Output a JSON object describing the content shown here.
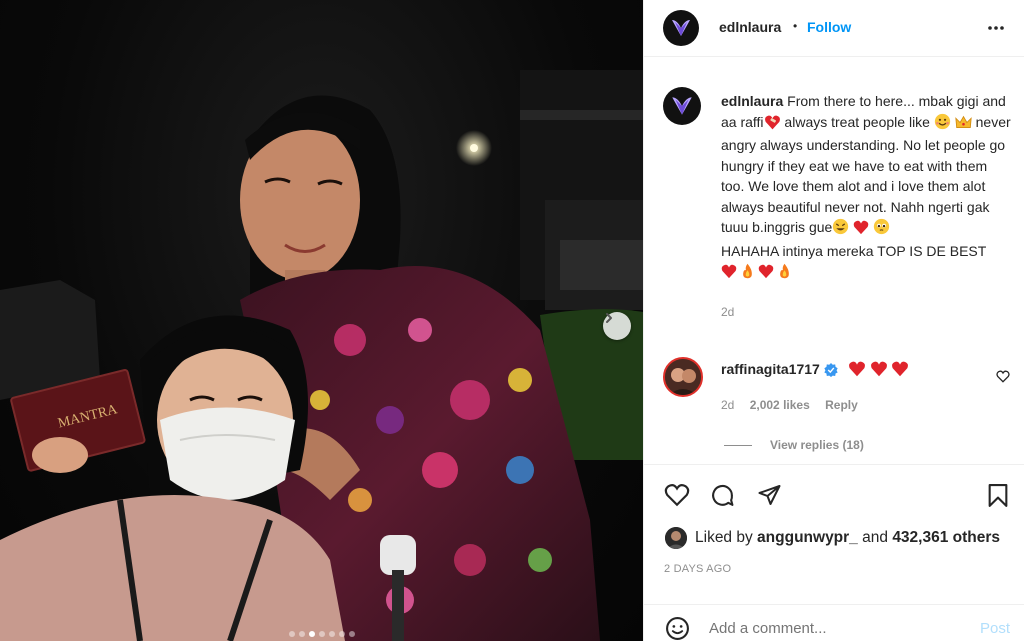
{
  "post": {
    "username": "edlnlaura",
    "follow_label": "Follow",
    "separator": "•",
    "photo": {
      "book_title": "MANTRA",
      "carousel_dots": 7,
      "active_dot": 2
    }
  },
  "caption": {
    "username": "edlnlaura",
    "parts": [
      "From there to here... mbak gigi and aa raffi",
      " always treat people like ",
      " never angry always understanding. No let people go hungry if they eat we have to eat with them too. We love them alot and i love them alot always beautiful never not. Nahh ngerti gak tuuu b.inggris gue",
      "HAHAHA intinya mereka TOP IS DE BEST"
    ],
    "time": "2d"
  },
  "comment": {
    "username": "raffinagita1717",
    "time": "2d",
    "likes": "2,002 likes",
    "reply_label": "Reply",
    "view_replies": "View replies (18)"
  },
  "likes": {
    "prefix": "Liked by",
    "user": "anggunwypr_",
    "and": "and",
    "others": "432,361 others"
  },
  "posted_ago": "2 DAYS AGO",
  "add_comment": {
    "placeholder": "Add a comment...",
    "post_label": "Post"
  },
  "colors": {
    "accent": "#0095f6",
    "heart": "#ed2a3c",
    "verified": "#3897f0"
  }
}
